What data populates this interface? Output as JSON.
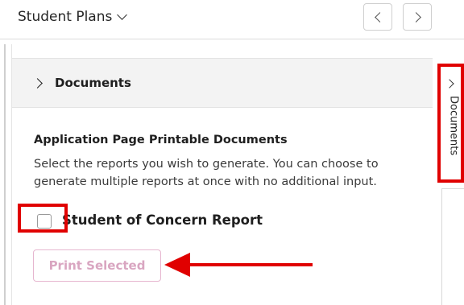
{
  "header": {
    "title": "Student Plans"
  },
  "section": {
    "title": "Documents"
  },
  "content": {
    "title": "Application Page Printable Documents",
    "description": "Select the reports you wish to generate. You can choose to generate multiple reports at once with no additional input."
  },
  "reports": [
    {
      "label": "Student of Concern Report",
      "checked": false
    }
  ],
  "actions": {
    "print_label": "Print Selected"
  },
  "side_tab": {
    "label": "Documents"
  },
  "colors": {
    "highlight": "#e00000",
    "print_button_text": "#d9a6c1",
    "print_button_border": "#e6b6cf",
    "section_header_bg": "#f3f3f3"
  }
}
